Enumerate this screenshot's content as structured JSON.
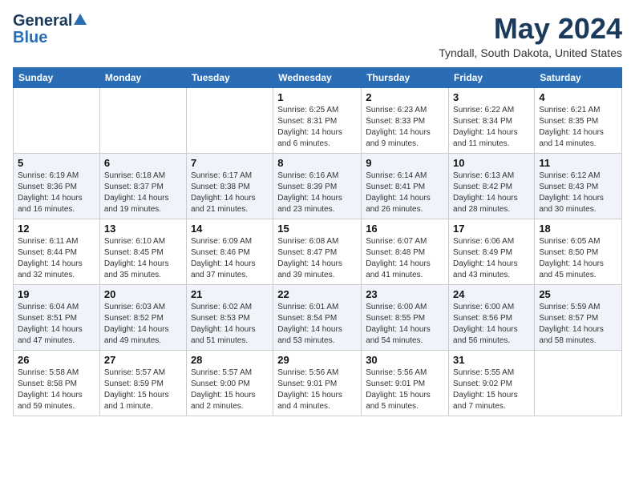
{
  "header": {
    "logo_general": "General",
    "logo_blue": "Blue",
    "month_title": "May 2024",
    "location": "Tyndall, South Dakota, United States"
  },
  "weekdays": [
    "Sunday",
    "Monday",
    "Tuesday",
    "Wednesday",
    "Thursday",
    "Friday",
    "Saturday"
  ],
  "weeks": [
    [
      {
        "day": "",
        "sunrise": "",
        "sunset": "",
        "daylight": ""
      },
      {
        "day": "",
        "sunrise": "",
        "sunset": "",
        "daylight": ""
      },
      {
        "day": "",
        "sunrise": "",
        "sunset": "",
        "daylight": ""
      },
      {
        "day": "1",
        "sunrise": "Sunrise: 6:25 AM",
        "sunset": "Sunset: 8:31 PM",
        "daylight": "Daylight: 14 hours and 6 minutes."
      },
      {
        "day": "2",
        "sunrise": "Sunrise: 6:23 AM",
        "sunset": "Sunset: 8:33 PM",
        "daylight": "Daylight: 14 hours and 9 minutes."
      },
      {
        "day": "3",
        "sunrise": "Sunrise: 6:22 AM",
        "sunset": "Sunset: 8:34 PM",
        "daylight": "Daylight: 14 hours and 11 minutes."
      },
      {
        "day": "4",
        "sunrise": "Sunrise: 6:21 AM",
        "sunset": "Sunset: 8:35 PM",
        "daylight": "Daylight: 14 hours and 14 minutes."
      }
    ],
    [
      {
        "day": "5",
        "sunrise": "Sunrise: 6:19 AM",
        "sunset": "Sunset: 8:36 PM",
        "daylight": "Daylight: 14 hours and 16 minutes."
      },
      {
        "day": "6",
        "sunrise": "Sunrise: 6:18 AM",
        "sunset": "Sunset: 8:37 PM",
        "daylight": "Daylight: 14 hours and 19 minutes."
      },
      {
        "day": "7",
        "sunrise": "Sunrise: 6:17 AM",
        "sunset": "Sunset: 8:38 PM",
        "daylight": "Daylight: 14 hours and 21 minutes."
      },
      {
        "day": "8",
        "sunrise": "Sunrise: 6:16 AM",
        "sunset": "Sunset: 8:39 PM",
        "daylight": "Daylight: 14 hours and 23 minutes."
      },
      {
        "day": "9",
        "sunrise": "Sunrise: 6:14 AM",
        "sunset": "Sunset: 8:41 PM",
        "daylight": "Daylight: 14 hours and 26 minutes."
      },
      {
        "day": "10",
        "sunrise": "Sunrise: 6:13 AM",
        "sunset": "Sunset: 8:42 PM",
        "daylight": "Daylight: 14 hours and 28 minutes."
      },
      {
        "day": "11",
        "sunrise": "Sunrise: 6:12 AM",
        "sunset": "Sunset: 8:43 PM",
        "daylight": "Daylight: 14 hours and 30 minutes."
      }
    ],
    [
      {
        "day": "12",
        "sunrise": "Sunrise: 6:11 AM",
        "sunset": "Sunset: 8:44 PM",
        "daylight": "Daylight: 14 hours and 32 minutes."
      },
      {
        "day": "13",
        "sunrise": "Sunrise: 6:10 AM",
        "sunset": "Sunset: 8:45 PM",
        "daylight": "Daylight: 14 hours and 35 minutes."
      },
      {
        "day": "14",
        "sunrise": "Sunrise: 6:09 AM",
        "sunset": "Sunset: 8:46 PM",
        "daylight": "Daylight: 14 hours and 37 minutes."
      },
      {
        "day": "15",
        "sunrise": "Sunrise: 6:08 AM",
        "sunset": "Sunset: 8:47 PM",
        "daylight": "Daylight: 14 hours and 39 minutes."
      },
      {
        "day": "16",
        "sunrise": "Sunrise: 6:07 AM",
        "sunset": "Sunset: 8:48 PM",
        "daylight": "Daylight: 14 hours and 41 minutes."
      },
      {
        "day": "17",
        "sunrise": "Sunrise: 6:06 AM",
        "sunset": "Sunset: 8:49 PM",
        "daylight": "Daylight: 14 hours and 43 minutes."
      },
      {
        "day": "18",
        "sunrise": "Sunrise: 6:05 AM",
        "sunset": "Sunset: 8:50 PM",
        "daylight": "Daylight: 14 hours and 45 minutes."
      }
    ],
    [
      {
        "day": "19",
        "sunrise": "Sunrise: 6:04 AM",
        "sunset": "Sunset: 8:51 PM",
        "daylight": "Daylight: 14 hours and 47 minutes."
      },
      {
        "day": "20",
        "sunrise": "Sunrise: 6:03 AM",
        "sunset": "Sunset: 8:52 PM",
        "daylight": "Daylight: 14 hours and 49 minutes."
      },
      {
        "day": "21",
        "sunrise": "Sunrise: 6:02 AM",
        "sunset": "Sunset: 8:53 PM",
        "daylight": "Daylight: 14 hours and 51 minutes."
      },
      {
        "day": "22",
        "sunrise": "Sunrise: 6:01 AM",
        "sunset": "Sunset: 8:54 PM",
        "daylight": "Daylight: 14 hours and 53 minutes."
      },
      {
        "day": "23",
        "sunrise": "Sunrise: 6:00 AM",
        "sunset": "Sunset: 8:55 PM",
        "daylight": "Daylight: 14 hours and 54 minutes."
      },
      {
        "day": "24",
        "sunrise": "Sunrise: 6:00 AM",
        "sunset": "Sunset: 8:56 PM",
        "daylight": "Daylight: 14 hours and 56 minutes."
      },
      {
        "day": "25",
        "sunrise": "Sunrise: 5:59 AM",
        "sunset": "Sunset: 8:57 PM",
        "daylight": "Daylight: 14 hours and 58 minutes."
      }
    ],
    [
      {
        "day": "26",
        "sunrise": "Sunrise: 5:58 AM",
        "sunset": "Sunset: 8:58 PM",
        "daylight": "Daylight: 14 hours and 59 minutes."
      },
      {
        "day": "27",
        "sunrise": "Sunrise: 5:57 AM",
        "sunset": "Sunset: 8:59 PM",
        "daylight": "Daylight: 15 hours and 1 minute."
      },
      {
        "day": "28",
        "sunrise": "Sunrise: 5:57 AM",
        "sunset": "Sunset: 9:00 PM",
        "daylight": "Daylight: 15 hours and 2 minutes."
      },
      {
        "day": "29",
        "sunrise": "Sunrise: 5:56 AM",
        "sunset": "Sunset: 9:01 PM",
        "daylight": "Daylight: 15 hours and 4 minutes."
      },
      {
        "day": "30",
        "sunrise": "Sunrise: 5:56 AM",
        "sunset": "Sunset: 9:01 PM",
        "daylight": "Daylight: 15 hours and 5 minutes."
      },
      {
        "day": "31",
        "sunrise": "Sunrise: 5:55 AM",
        "sunset": "Sunset: 9:02 PM",
        "daylight": "Daylight: 15 hours and 7 minutes."
      },
      {
        "day": "",
        "sunrise": "",
        "sunset": "",
        "daylight": ""
      }
    ]
  ]
}
